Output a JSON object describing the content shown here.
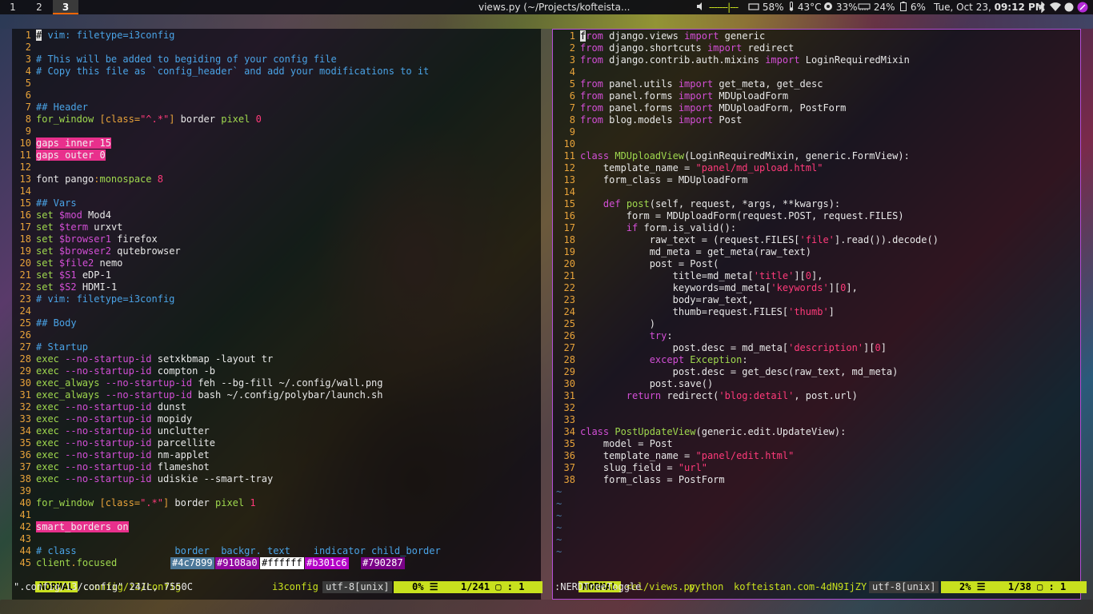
{
  "bar": {
    "workspaces": [
      "1",
      "2",
      "3"
    ],
    "active_workspace": "3",
    "title": "views.py (~/Projects/kofteista...",
    "volume_bar": "-------|---",
    "brightness": "58%",
    "temperature": "43°C",
    "cpu": "33%",
    "memory": "24%",
    "battery": "6%",
    "date": "Tue, Oct 23",
    "time": "09:12 PM"
  },
  "left_pane": {
    "lines": [
      {
        "n": "1",
        "t": "# vim: filetype=i3config",
        "k": "com-cursor"
      },
      {
        "n": "2",
        "t": ""
      },
      {
        "n": "3",
        "t": "# This will be added to begiding of your config file",
        "k": "com"
      },
      {
        "n": "4",
        "t": "# Copy this file as `config_header` and add your modifications to it",
        "k": "com"
      },
      {
        "n": "5",
        "t": ""
      },
      {
        "n": "6",
        "t": ""
      },
      {
        "n": "7",
        "t": "## Header",
        "k": "com"
      },
      {
        "n": "8",
        "t": "for_window [class=\"^.*\"] border pixel 0",
        "k": "forwin"
      },
      {
        "n": "9",
        "t": ""
      },
      {
        "n": "10",
        "t": "gaps inner 15",
        "k": "pink"
      },
      {
        "n": "11",
        "t": "gaps outer 0",
        "k": "pink"
      },
      {
        "n": "12",
        "t": ""
      },
      {
        "n": "13",
        "t": "font pango:monospace 8",
        "k": "font"
      },
      {
        "n": "14",
        "t": ""
      },
      {
        "n": "15",
        "t": "## Vars",
        "k": "com"
      },
      {
        "n": "16",
        "t": "set $mod Mod4",
        "k": "set"
      },
      {
        "n": "17",
        "t": "set $term urxvt",
        "k": "set"
      },
      {
        "n": "18",
        "t": "set $browser1 firefox",
        "k": "set"
      },
      {
        "n": "19",
        "t": "set $browser2 qutebrowser",
        "k": "set"
      },
      {
        "n": "20",
        "t": "set $file2 nemo",
        "k": "set"
      },
      {
        "n": "21",
        "t": "set $S1 eDP-1",
        "k": "set"
      },
      {
        "n": "22",
        "t": "set $S2 HDMI-1",
        "k": "set"
      },
      {
        "n": "23",
        "t": "# vim: filetype=i3config",
        "k": "com"
      },
      {
        "n": "24",
        "t": ""
      },
      {
        "n": "25",
        "t": "## Body",
        "k": "com"
      },
      {
        "n": "26",
        "t": ""
      },
      {
        "n": "27",
        "t": "# Startup",
        "k": "com"
      },
      {
        "n": "28",
        "t": "exec --no-startup-id setxkbmap -layout tr",
        "k": "exec"
      },
      {
        "n": "29",
        "t": "exec --no-startup-id compton -b",
        "k": "exec"
      },
      {
        "n": "30",
        "t": "exec_always --no-startup-id feh --bg-fill ~/.config/wall.png",
        "k": "exec"
      },
      {
        "n": "31",
        "t": "exec_always --no-startup-id bash ~/.config/polybar/launch.sh",
        "k": "exec"
      },
      {
        "n": "32",
        "t": "exec --no-startup-id dunst",
        "k": "exec"
      },
      {
        "n": "33",
        "t": "exec --no-startup-id mopidy",
        "k": "exec"
      },
      {
        "n": "34",
        "t": "exec --no-startup-id unclutter",
        "k": "exec"
      },
      {
        "n": "35",
        "t": "exec --no-startup-id parcellite",
        "k": "exec"
      },
      {
        "n": "36",
        "t": "exec --no-startup-id nm-applet",
        "k": "exec"
      },
      {
        "n": "37",
        "t": "exec --no-startup-id flameshot",
        "k": "exec"
      },
      {
        "n": "38",
        "t": "exec --no-startup-id udiskie --smart-tray",
        "k": "exec"
      },
      {
        "n": "39",
        "t": ""
      },
      {
        "n": "40",
        "t": "for_window [class=\".*\"] border pixel 1",
        "k": "forwin"
      },
      {
        "n": "41",
        "t": ""
      },
      {
        "n": "42",
        "t": "smart_borders on",
        "k": "pink"
      },
      {
        "n": "43",
        "t": ""
      },
      {
        "n": "44",
        "t": "# class                 border  backgr. text    indicator child_border",
        "k": "com"
      },
      {
        "n": "45",
        "t": "client.focused",
        "k": "client"
      }
    ],
    "client_colors": [
      "#4c7899",
      "#9108a0",
      "#ffffff",
      "#b301c6",
      "#790287"
    ],
    "client_color_hex": [
      "#4c7899",
      "#9108a0",
      "#ffffff",
      "#b301c6",
      "#790287"
    ],
    "status": {
      "mode": "NORMAL",
      "file": ".config/i3/config",
      "filetype": "i3config",
      "encoding": "utf-8[unix]",
      "percent": "0%",
      "position": "1/241",
      "column": "1"
    },
    "cmdline": "\".config/i3/config\" 241L, 7550C"
  },
  "right_pane": {
    "lines": [
      {
        "n": "1",
        "t": "from django.views import generic"
      },
      {
        "n": "2",
        "t": "from django.shortcuts import redirect"
      },
      {
        "n": "3",
        "t": "from django.contrib.auth.mixins import LoginRequiredMixin"
      },
      {
        "n": "4",
        "t": ""
      },
      {
        "n": "5",
        "t": "from panel.utils import get_meta, get_desc"
      },
      {
        "n": "6",
        "t": "from panel.forms import MDUploadForm"
      },
      {
        "n": "7",
        "t": "from panel.forms import MDUploadForm, PostForm"
      },
      {
        "n": "8",
        "t": "from blog.models import Post"
      },
      {
        "n": "9",
        "t": ""
      },
      {
        "n": "10",
        "t": ""
      },
      {
        "n": "11",
        "t": "class MDUploadView(LoginRequiredMixin, generic.FormView):"
      },
      {
        "n": "12",
        "t": "    template_name = \"panel/md_upload.html\""
      },
      {
        "n": "13",
        "t": "    form_class = MDUploadForm"
      },
      {
        "n": "14",
        "t": ""
      },
      {
        "n": "15",
        "t": "    def post(self, request, *args, **kwargs):"
      },
      {
        "n": "16",
        "t": "        form = MDUploadForm(request.POST, request.FILES)"
      },
      {
        "n": "17",
        "t": "        if form.is_valid():"
      },
      {
        "n": "18",
        "t": "            raw_text = (request.FILES['file'].read()).decode()"
      },
      {
        "n": "19",
        "t": "            md_meta = get_meta(raw_text)"
      },
      {
        "n": "20",
        "t": "            post = Post("
      },
      {
        "n": "21",
        "t": "                title=md_meta['title'][0],"
      },
      {
        "n": "22",
        "t": "                keywords=md_meta['keywords'][0],"
      },
      {
        "n": "23",
        "t": "                body=raw_text,"
      },
      {
        "n": "24",
        "t": "                thumb=request.FILES['thumb']"
      },
      {
        "n": "25",
        "t": "            )"
      },
      {
        "n": "26",
        "t": "            try:"
      },
      {
        "n": "27",
        "t": "                post.desc = md_meta['description'][0]"
      },
      {
        "n": "28",
        "t": "            except Exception:"
      },
      {
        "n": "29",
        "t": "                post.desc = get_desc(raw_text, md_meta)"
      },
      {
        "n": "30",
        "t": "            post.save()"
      },
      {
        "n": "31",
        "t": "        return redirect('blog:detail', post.url)"
      },
      {
        "n": "32",
        "t": ""
      },
      {
        "n": "33",
        "t": ""
      },
      {
        "n": "34",
        "t": "class PostUpdateView(generic.edit.UpdateView):"
      },
      {
        "n": "35",
        "t": "    model = Post"
      },
      {
        "n": "36",
        "t": "    template_name = \"panel/edit.html\""
      },
      {
        "n": "37",
        "t": "    slug_field = \"url\""
      },
      {
        "n": "38",
        "t": "    form_class = PostForm"
      }
    ],
    "tilde_count": 6,
    "status": {
      "mode": "NORMAL",
      "file": "<el/views.py",
      "filetype": "python",
      "branch": "kofteistan.com-4dN9IjZY",
      "encoding": "utf-8[unix]",
      "percent": "2%",
      "position": "1/38",
      "column": "1"
    },
    "cmdline": ":NERDTreeToggle"
  }
}
